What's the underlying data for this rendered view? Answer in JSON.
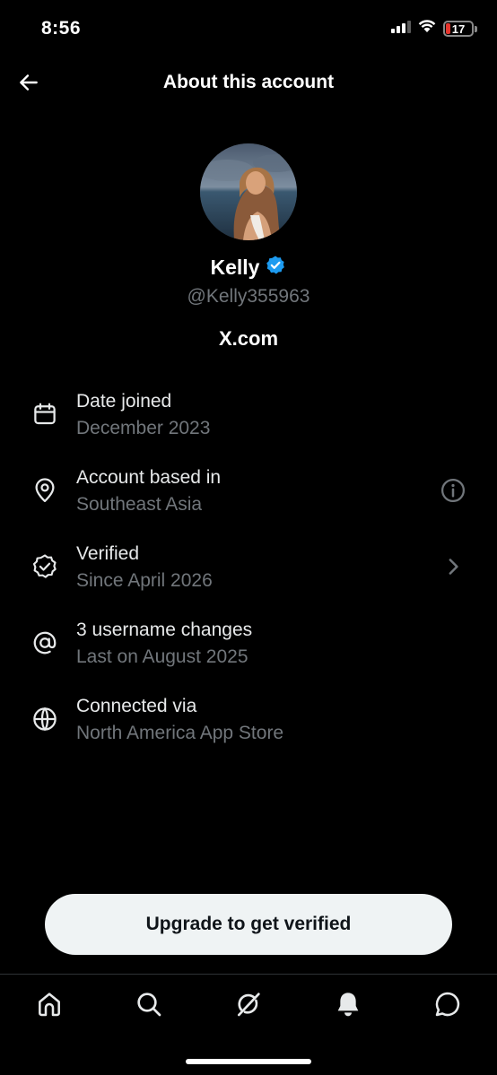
{
  "status_bar": {
    "time": "8:56",
    "battery_level": "17",
    "battery_fraction": 0.17,
    "battery_color": "#e5352d",
    "icons": [
      "cellular-signal-icon",
      "wifi-icon",
      "battery-icon"
    ]
  },
  "header": {
    "title": "About this account",
    "back_icon": "arrow-left-icon"
  },
  "profile": {
    "display_name": "Kelly",
    "verified_badge_color": "#1d9bf0",
    "handle": "@Kelly355963",
    "site": "X.com"
  },
  "info": {
    "date_joined": {
      "title": "Date joined",
      "value": "December 2023",
      "icon": "calendar-icon"
    },
    "location": {
      "title": "Account based in",
      "value": "Southeast Asia",
      "icon": "location-pin-icon",
      "action_icon": "info-icon"
    },
    "verified": {
      "title": "Verified",
      "value": "Since April 2026",
      "icon": "verified-badge-icon",
      "action_icon": "chevron-right-icon"
    },
    "username_changes": {
      "title": "3 username changes",
      "value": "Last on August 2025",
      "icon": "at-sign-icon"
    },
    "connected_via": {
      "title": "Connected via",
      "value": "North America App Store",
      "icon": "globe-icon"
    }
  },
  "upgrade_button": {
    "label": "Upgrade to get verified"
  },
  "bottom_nav": {
    "items": [
      "home-icon",
      "search-icon",
      "grok-icon",
      "notifications-icon",
      "messages-icon"
    ]
  },
  "colors": {
    "background": "#000000",
    "primary_text": "#e7e9ea",
    "secondary_text": "#71767b",
    "accent": "#1d9bf0",
    "button_background": "#eff3f4"
  }
}
